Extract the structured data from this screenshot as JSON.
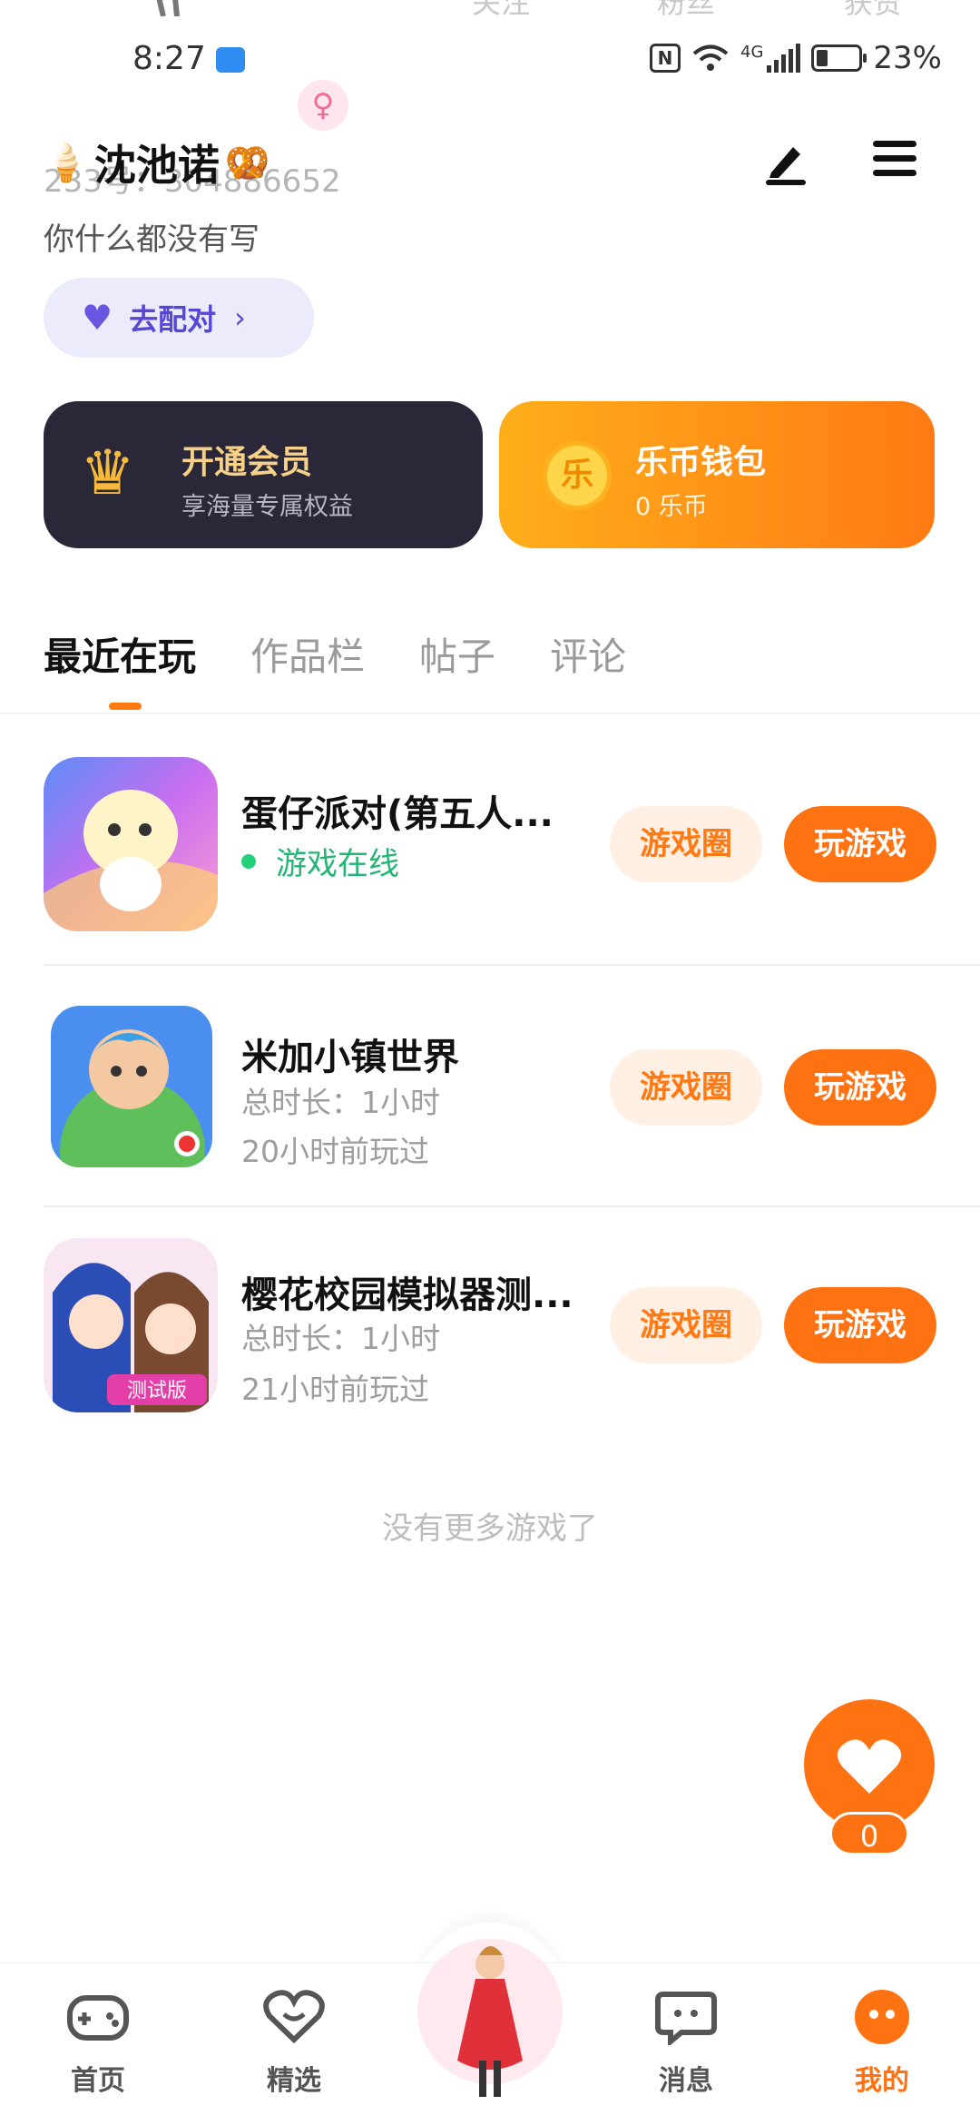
{
  "status_bar": {
    "time": "8:27",
    "network": "4G",
    "battery": "23%"
  },
  "top_stats": {
    "following": "关注",
    "fans": "粉丝",
    "likes": "获赞"
  },
  "profile": {
    "name": "沈池诺",
    "uid": "233号：304886652",
    "gender_symbol": "♀",
    "bio": "你什么都没有写",
    "match_button": "去配对"
  },
  "cards": {
    "vip": {
      "title": "开通会员",
      "subtitle": "享海量专属权益"
    },
    "wallet": {
      "title": "乐币钱包",
      "subtitle": "0 乐币",
      "coin_char": "乐"
    }
  },
  "tabs": [
    "最近在玩",
    "作品栏",
    "帖子",
    "评论"
  ],
  "games": [
    {
      "title": "蛋仔派对(第五人...",
      "status": "游戏在线",
      "duration": "",
      "last_played": ""
    },
    {
      "title": "米加小镇世界",
      "status": "",
      "duration": "总时长：1小时",
      "last_played": "20小时前玩过"
    },
    {
      "title": "樱花校园模拟器测...",
      "status": "",
      "duration": "总时长：1小时",
      "last_played": "21小时前玩过"
    }
  ],
  "game_actions": {
    "circle": "游戏圈",
    "play": "玩游戏"
  },
  "footer_note": "没有更多游戏了",
  "like_count": "0",
  "nav": {
    "home": "首页",
    "featured": "精选",
    "messages": "消息",
    "mine": "我的"
  },
  "colors": {
    "accent": "#ff7211",
    "online": "#22b573",
    "match": "#5847d4"
  }
}
